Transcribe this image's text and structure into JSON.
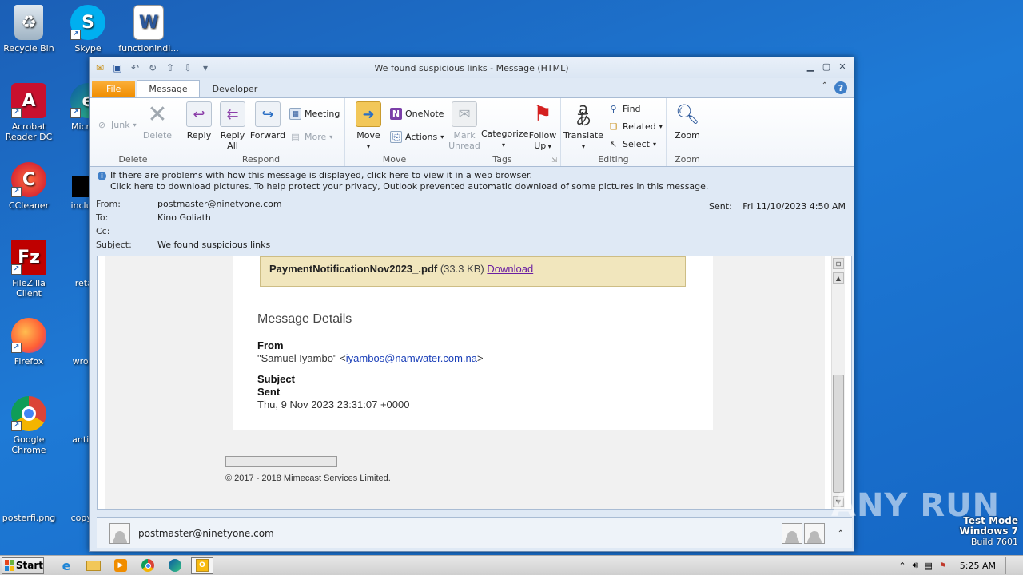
{
  "desktop": {
    "icons": [
      {
        "label": "Recycle Bin",
        "icon": "recycle-bin-icon"
      },
      {
        "label": "Skype",
        "icon": "skype-icon"
      },
      {
        "label": "functionindi...",
        "icon": "word-document-icon"
      },
      {
        "label": "Acrobat Reader DC",
        "icon": "acrobat-icon"
      },
      {
        "label": "Microso",
        "icon": "edge-icon"
      },
      {
        "label": "CCleaner",
        "icon": "ccleaner-icon"
      },
      {
        "label": "includin",
        "icon": "file-icon"
      },
      {
        "label": "FileZilla Client",
        "icon": "filezilla-icon"
      },
      {
        "label": "retailt",
        "icon": "file-icon"
      },
      {
        "label": "Firefox",
        "icon": "firefox-icon"
      },
      {
        "label": "wroteir",
        "icon": "file-icon"
      },
      {
        "label": "Google Chrome",
        "icon": "chrome-icon"
      },
      {
        "label": "antirati",
        "icon": "file-icon"
      },
      {
        "label": "posterfi.png",
        "icon": "image-file-icon"
      },
      {
        "label": "copygiv",
        "icon": "file-icon"
      }
    ]
  },
  "window": {
    "title": "We found suspicious links  -  Message (HTML)",
    "tabs": [
      "File",
      "Message",
      "Developer"
    ],
    "active_tab": "Message"
  },
  "ribbon": {
    "delete": {
      "label": "Delete",
      "junk": "Junk",
      "delete_btn": "Delete"
    },
    "respond": {
      "label": "Respond",
      "reply": "Reply",
      "reply_all_1": "Reply",
      "reply_all_2": "All",
      "forward": "Forward",
      "meeting": "Meeting",
      "more": "More"
    },
    "move": {
      "label": "Move",
      "move_btn": "Move",
      "onenote": "OneNote",
      "actions": "Actions"
    },
    "tags": {
      "label": "Tags",
      "mark_1": "Mark",
      "mark_2": "Unread",
      "categorize": "Categorize",
      "follow_1": "Follow",
      "follow_2": "Up"
    },
    "editing": {
      "label": "Editing",
      "translate": "Translate",
      "find": "Find",
      "related": "Related",
      "select": "Select"
    },
    "zoom": {
      "label": "Zoom",
      "zoom_btn": "Zoom"
    }
  },
  "infobar": {
    "line1": "If there are problems with how this message is displayed, click here to view it in a web browser.",
    "line2": "Click here to download pictures. To help protect your privacy, Outlook prevented automatic download of some pictures in this message."
  },
  "headers": {
    "from_label": "From:",
    "from": "postmaster@ninetyone.com",
    "to_label": "To:",
    "to": "Kino Goliath",
    "cc_label": "Cc:",
    "cc": "",
    "subject_label": "Subject:",
    "subject": "We found suspicious links",
    "sent_label": "Sent:",
    "sent": "Fri 11/10/2023 4:50 AM"
  },
  "body": {
    "attachment_name": "PaymentNotificationNov2023_.pdf",
    "attachment_size": "(33.3 KB)",
    "download": "Download",
    "details_title": "Message Details",
    "from_heading": "From",
    "from_name": "\"Samuel Iyambo\" <",
    "from_email": "iyambos@namwater.com.na",
    "from_close": ">",
    "subject_heading": "Subject",
    "sent_heading": "Sent",
    "sent_value": "Thu, 9 Nov 2023 23:31:07 +0000",
    "copyright": "© 2017 - 2018 Mimecast Services Limited."
  },
  "people_pane": {
    "name": "postmaster@ninetyone.com"
  },
  "taskbar": {
    "start": "Start",
    "time": "5:25 AM"
  },
  "watermark": {
    "line1": "Test Mode",
    "line2": "Windows 7",
    "line3": "Build 7601",
    "brand": "ANY RUN"
  }
}
